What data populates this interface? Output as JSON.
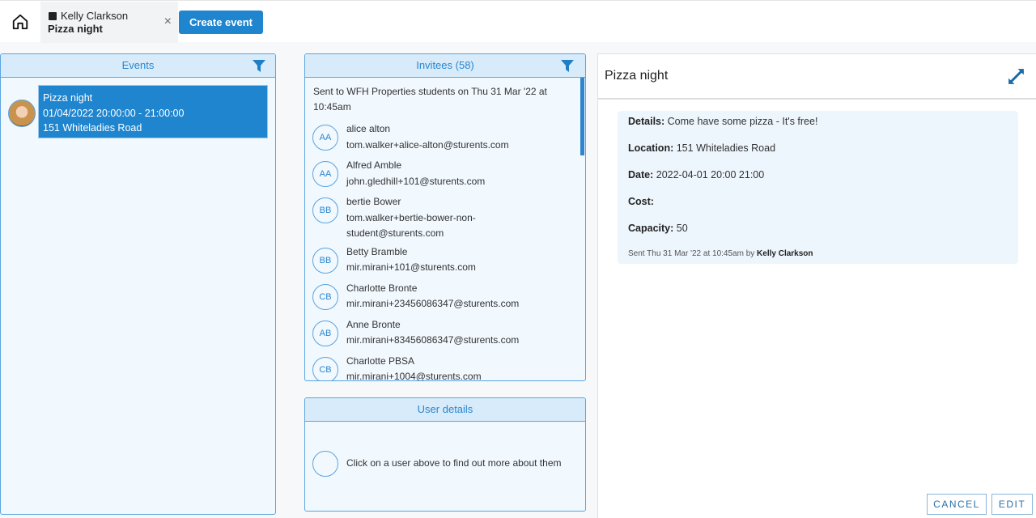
{
  "topbar": {
    "tab_user": "Kelly Clarkson",
    "tab_event": "Pizza night",
    "close": "×",
    "create_label": "Create event"
  },
  "events": {
    "title": "Events",
    "items": [
      {
        "name": "Pizza night",
        "time": "01/04/2022 20:00:00 - 21:00:00",
        "location": "151 Whiteladies Road"
      }
    ]
  },
  "invitees": {
    "title": "Invitees (58)",
    "sent": "Sent to WFH Properties students on Thu 31 Mar '22 at 10:45am",
    "items": [
      {
        "initials": "AA",
        "name": "alice alton",
        "email": "tom.walker+alice-alton@sturents.com"
      },
      {
        "initials": "AA",
        "name": "Alfred Amble",
        "email": "john.gledhill+101@sturents.com"
      },
      {
        "initials": "BB",
        "name": "bertie Bower",
        "email": "tom.walker+bertie-bower-non-student@sturents.com"
      },
      {
        "initials": "BB",
        "name": "Betty Bramble",
        "email": "mir.mirani+101@sturents.com"
      },
      {
        "initials": "CB",
        "name": "Charlotte Bronte",
        "email": "mir.mirani+23456086347@sturents.com"
      },
      {
        "initials": "AB",
        "name": "Anne Bronte",
        "email": "mir.mirani+83456086347@sturents.com"
      },
      {
        "initials": "CB",
        "name": "Charlotte PBSA",
        "email": "mir.mirani+1004@sturents.com"
      }
    ]
  },
  "user_details": {
    "title": "User details",
    "hint": "Click on a user above to find out more about them"
  },
  "detail": {
    "title": "Pizza night",
    "fields": [
      {
        "label": "Details:",
        "value": "Come have some pizza - It's free!"
      },
      {
        "label": "Location:",
        "value": "151 Whiteladies Road"
      },
      {
        "label": "Date:",
        "value": "2022-04-01 20:00 21:00"
      },
      {
        "label": "Cost:",
        "value": ""
      },
      {
        "label": "Capacity:",
        "value": "50"
      }
    ],
    "sent_prefix": "Sent Thu 31 Mar '22 at 10:45am by",
    "sent_by": "Kelly Clarkson",
    "cancel": "CANCEL",
    "edit": "EDIT"
  }
}
